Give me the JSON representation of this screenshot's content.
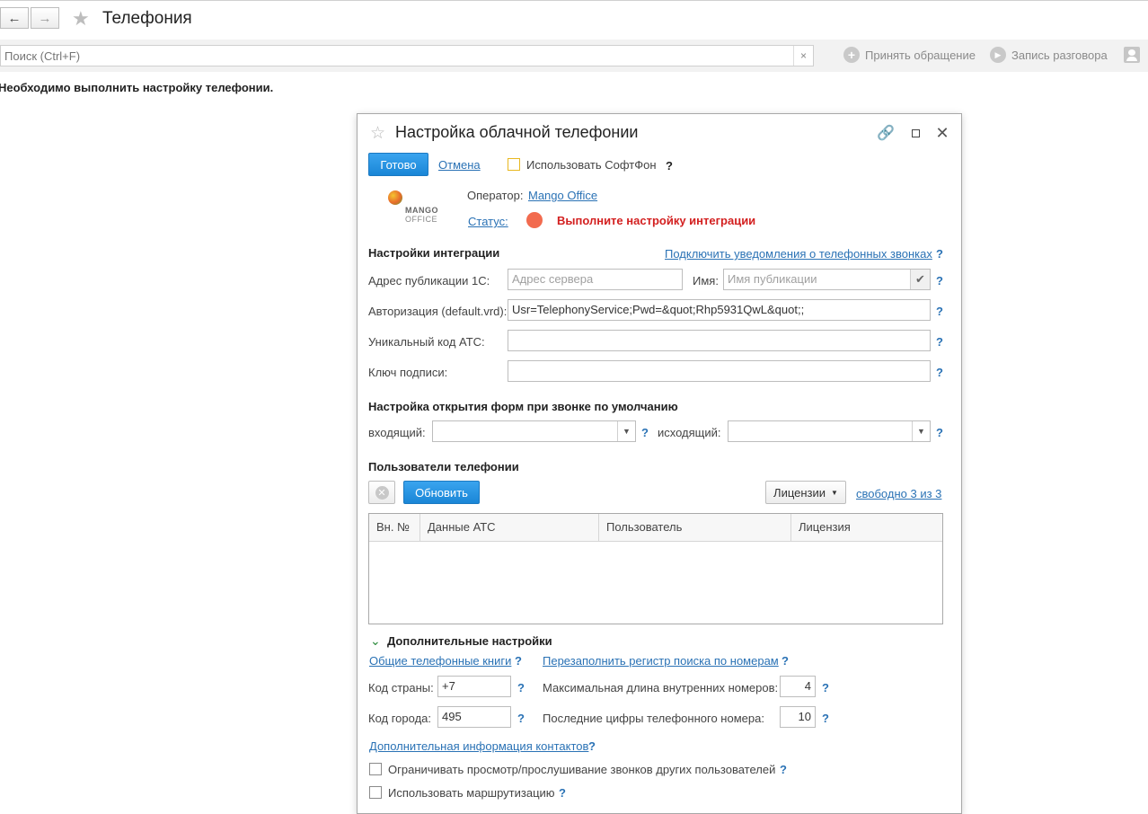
{
  "header": {
    "title": "Телефония",
    "back_icon": "arrow-left-icon",
    "forward_icon": "arrow-right-icon",
    "favorite_icon": "star-icon"
  },
  "toolbar": {
    "search_placeholder": "Поиск (Ctrl+F)",
    "clear_glyph": "×",
    "accept_call": "Принять обращение",
    "record_call": "Запись разговора"
  },
  "notice": "Необходимо выполнить настройку телефонии.",
  "dialog": {
    "title": "Настройка облачной телефонии",
    "done_label": "Готово",
    "cancel_label": "Отмена",
    "softphone_label": "Использовать СофтФон",
    "help": "?",
    "logo_line1": "MANGO",
    "logo_line2": "OFFICE",
    "operator_label": "Оператор:",
    "operator_value": "Mango Office",
    "status_label": "Статус:",
    "status_value": "Выполните настройку интеграции",
    "status_color": "#f26b4f",
    "integration": {
      "title": "Настройки интеграции",
      "notify_link": "Подключить уведомления о телефонных звонках",
      "address_label": "Адрес публикации 1С:",
      "address_placeholder": "Адрес сервера",
      "name_label": "Имя:",
      "name_placeholder": "Имя публикации",
      "auth_label": "Авторизация (default.vrd):",
      "auth_value": "Usr=TelephonyService;Pwd=&quot;Rhp5931QwL&quot;;",
      "ats_label": "Уникальный код АТС:",
      "ats_value": "",
      "key_label": "Ключ подписи:",
      "key_value": ""
    },
    "forms": {
      "title": "Настройка открытия форм при звонке по умолчанию",
      "incoming_label": "входящий:",
      "outgoing_label": "исходящий:"
    },
    "users": {
      "title": "Пользователи телефонии",
      "refresh_label": "Обновить",
      "licenses_label": "Лицензии",
      "free_link": "свободно 3 из 3",
      "columns": [
        "Вн. №",
        "Данные АТС",
        "Пользователь",
        "Лицензия"
      ]
    },
    "extra": {
      "title": "Дополнительные настройки",
      "phonebooks_link": "Общие телефонные книги",
      "refill_link": "Перезаполнить регистр поиска по номерам",
      "country_label": "Код страны:",
      "country_value": "+7",
      "city_label": "Код города:",
      "city_value": "495",
      "maxlen_label": "Максимальная длина внутренних номеров:",
      "maxlen_value": "4",
      "lastdigits_label": "Последние цифры телефонного номера:",
      "lastdigits_value": "10",
      "contacts_link": "Дополнительная информация контактов",
      "restrict_label": "Ограничивать просмотр/прослушивание звонков других пользователей",
      "routing_label": "Использовать маршрутизацию"
    }
  }
}
